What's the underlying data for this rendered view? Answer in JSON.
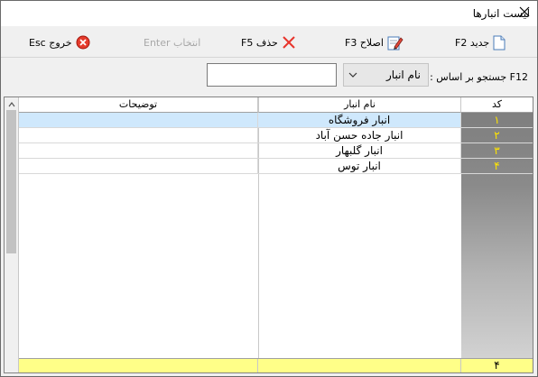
{
  "window": {
    "title": "لیست انبارها"
  },
  "toolbar": {
    "new_label": "جدید F2",
    "edit_label": "اصلاح F3",
    "delete_label": "حذف F5",
    "select_label": "انتخاب Enter",
    "exit_label": "خروج Esc"
  },
  "search": {
    "label": "F12 جستجو بر اساس :",
    "field_value": "نام انبار",
    "input_value": ""
  },
  "grid": {
    "columns": [
      "کد",
      "نام انبار",
      "توضیحات"
    ],
    "rows": [
      {
        "code": "۱",
        "name": "انبار فروشگاه",
        "desc": ""
      },
      {
        "code": "۲",
        "name": "انبار جاده حسن آباد",
        "desc": ""
      },
      {
        "code": "۳",
        "name": "انبار گلبهار",
        "desc": ""
      },
      {
        "code": "۴",
        "name": "انبار توس",
        "desc": ""
      }
    ],
    "footer_count": "۴"
  },
  "colors": {
    "code_text": "#ffe400",
    "selected_row": "#cfe8fc",
    "footer_bg": "#ffff88"
  }
}
